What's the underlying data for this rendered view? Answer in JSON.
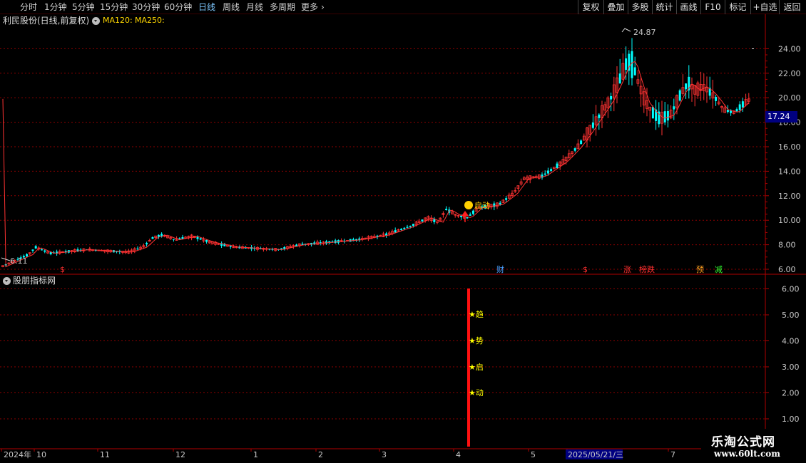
{
  "toolbar": {
    "timeframes": [
      "分时",
      "1分钟",
      "5分钟",
      "15分钟",
      "30分钟",
      "60分钟",
      "日线",
      "周线",
      "月线",
      "多周期",
      "更多"
    ],
    "selected_index": 6,
    "right_buttons": [
      "复权",
      "叠加",
      "多股",
      "统计",
      "画线",
      "F10",
      "标记",
      "+自选",
      "返回"
    ]
  },
  "main_panel": {
    "title": "利民股份(日线,前复权)",
    "ma_labels": [
      "MA120:",
      "MA250:"
    ],
    "y_ticks": [
      "24.00",
      "22.00",
      "20.00",
      "18.00",
      "16.00",
      "14.00",
      "12.00",
      "10.00",
      "8.00",
      "6.00"
    ],
    "y_values": [
      24,
      22,
      20,
      18,
      16,
      14,
      12,
      10,
      8,
      6
    ],
    "y_min": 5.0,
    "y_max": 25.5,
    "current_price": "17.24",
    "high_label": "24.87",
    "low_label": "6.11",
    "event_markers": [
      {
        "text": "$",
        "color": "#ff3030"
      },
      {
        "text": "财",
        "color": "#4aa0ff"
      },
      {
        "text": "$",
        "color": "#ff3030"
      },
      {
        "text": "涨",
        "color": "#ff3030"
      },
      {
        "text": "榜跌",
        "color": "#ff3030"
      },
      {
        "text": "预",
        "color": "#ffa020"
      },
      {
        "text": "减",
        "color": "#30ff30"
      }
    ],
    "signal_label": "启动"
  },
  "indicator_panel": {
    "title": "股朋指标网",
    "y_ticks": [
      "6.00",
      "5.00",
      "4.00",
      "3.00",
      "2.00",
      "1.00"
    ],
    "star_labels": [
      "★趋",
      "★势",
      "★启",
      "★动"
    ]
  },
  "date_axis": {
    "labels": [
      "2024年",
      "10",
      "11",
      "12",
      "1",
      "2",
      "3",
      "4",
      "5",
      "2025/05/21/三",
      "7"
    ]
  },
  "brand": {
    "line1": "乐淘公式网",
    "line2": "www.60lt.com"
  },
  "colors": {
    "up": "#ff3232",
    "down": "#00ffff",
    "ma": "#ff3232",
    "grid": "#8b0000",
    "signal_bar": "#ff1010",
    "star": "#ffff00"
  },
  "chart_data": {
    "type": "candlestick",
    "x": [
      "2024-09",
      "2024-10",
      "2024-11",
      "2024-12",
      "2025-01",
      "2025-02",
      "2025-03",
      "2025-04",
      "2025-05",
      "2025-06",
      "2025-07"
    ],
    "close_approx": [
      6.3,
      7.6,
      7.5,
      8.6,
      7.6,
      8.3,
      9.0,
      10.8,
      13.5,
      22.0,
      19.8
    ],
    "high": 24.87,
    "low": 6.11,
    "last": 17.24,
    "ylim": [
      5.0,
      25.5
    ]
  }
}
